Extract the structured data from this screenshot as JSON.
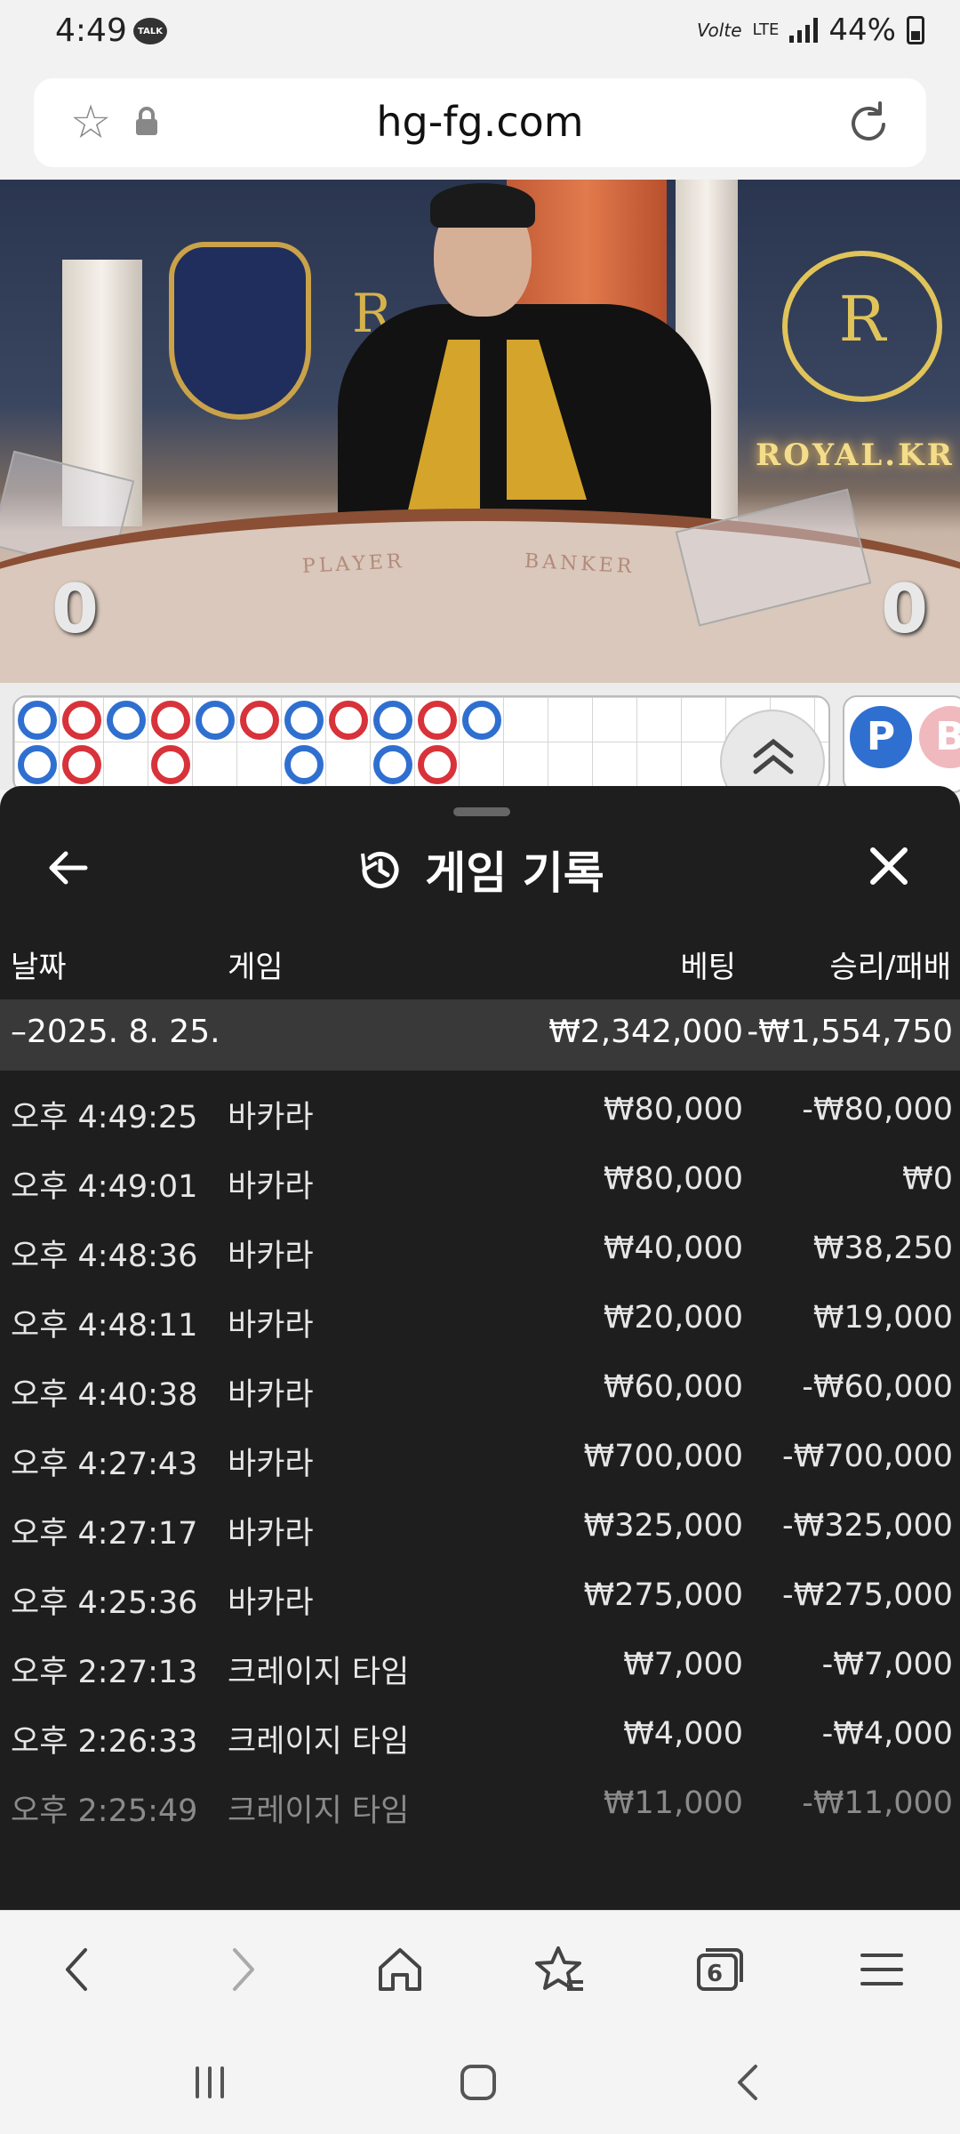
{
  "status_bar": {
    "time": "4:49",
    "talk_badge": "TALK",
    "volte": "Volte",
    "lte": "LTE",
    "battery": "44%"
  },
  "browser": {
    "url": "hg-fg.com",
    "tab_count": "6"
  },
  "video": {
    "player_score": "0",
    "banker_score": "0",
    "table_player": "PLAYER",
    "table_banker": "BANKER",
    "brand": "ROYAL.KR",
    "crest_letter": "R"
  },
  "roadmap": {
    "player_label": "P",
    "banker_label": "B"
  },
  "history": {
    "title": "게임 기록",
    "columns": {
      "date": "날짜",
      "game": "게임",
      "bet": "베팅",
      "result": "승리/패배"
    },
    "date_group": {
      "date": "–2025. 8. 25.",
      "bet_total": "₩2,342,000",
      "result_total": "-₩1,554,750"
    },
    "rows": [
      {
        "time": "오후 4:49:25",
        "game": "바카라",
        "bet": "₩80,000",
        "result": "-₩80,000"
      },
      {
        "time": "오후 4:49:01",
        "game": "바카라",
        "bet": "₩80,000",
        "result": "₩0"
      },
      {
        "time": "오후 4:48:36",
        "game": "바카라",
        "bet": "₩40,000",
        "result": "₩38,250"
      },
      {
        "time": "오후 4:48:11",
        "game": "바카라",
        "bet": "₩20,000",
        "result": "₩19,000"
      },
      {
        "time": "오후 4:40:38",
        "game": "바카라",
        "bet": "₩60,000",
        "result": "-₩60,000"
      },
      {
        "time": "오후 4:27:43",
        "game": "바카라",
        "bet": "₩700,000",
        "result": "-₩700,000"
      },
      {
        "time": "오후 4:27:17",
        "game": "바카라",
        "bet": "₩325,000",
        "result": "-₩325,000"
      },
      {
        "time": "오후 4:25:36",
        "game": "바카라",
        "bet": "₩275,000",
        "result": "-₩275,000"
      },
      {
        "time": "오후 2:27:13",
        "game": "크레이지 타임",
        "bet": "₩7,000",
        "result": "-₩7,000"
      },
      {
        "time": "오후 2:26:33",
        "game": "크레이지 타임",
        "bet": "₩4,000",
        "result": "-₩4,000"
      },
      {
        "time": "오후 2:25:49",
        "game": "크레이지 타임",
        "bet": "₩11,000",
        "result": "-₩11,000"
      }
    ]
  },
  "icons": {
    "back": "arrow-left-icon",
    "close": "close-icon",
    "history": "history-icon",
    "bookmark": "star-icon",
    "lock": "lock-icon",
    "refresh": "refresh-icon"
  }
}
